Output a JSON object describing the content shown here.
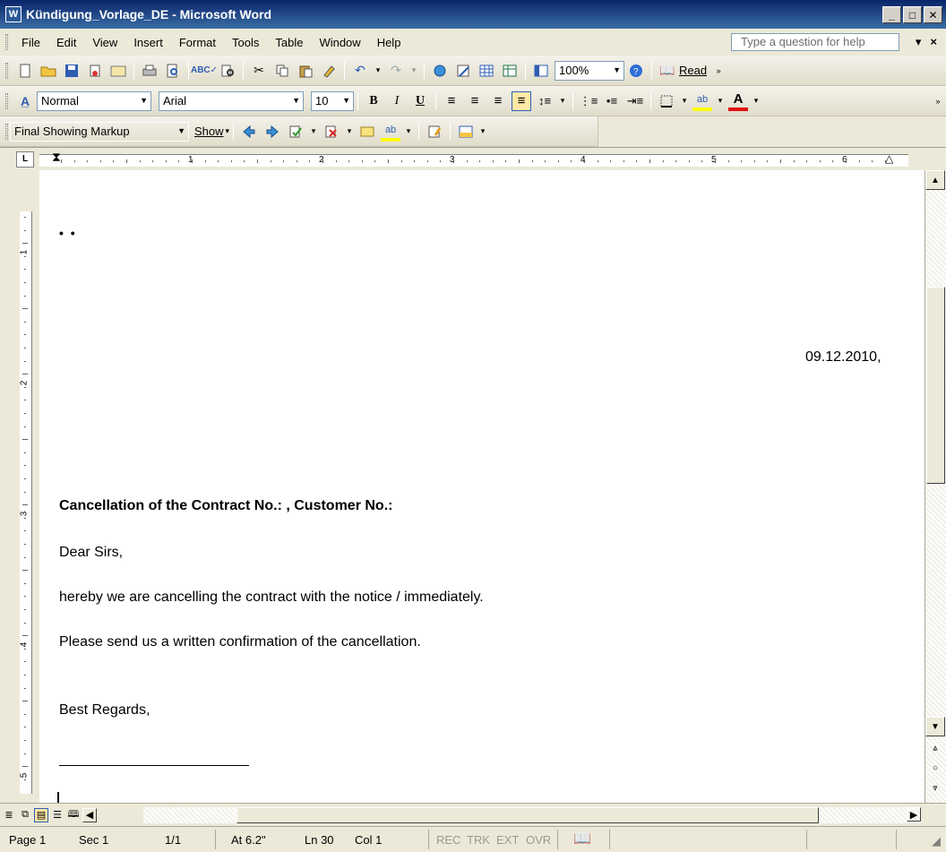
{
  "window": {
    "title": "Kündigung_Vorlage_DE - Microsoft Word",
    "app_icon_letter": "W"
  },
  "menubar": {
    "items": [
      "File",
      "Edit",
      "View",
      "Insert",
      "Format",
      "Tools",
      "Table",
      "Window",
      "Help"
    ],
    "help_placeholder": "Type a question for help",
    "close_glyph": "×"
  },
  "toolbar_standard": {
    "zoom": "100%",
    "read_label": "Read"
  },
  "toolbar_formatting": {
    "style": "Normal",
    "font": "Arial",
    "size": "10",
    "bold_label": "B",
    "italic_label": "I",
    "underline_label": "U",
    "font_color_label": "A"
  },
  "toolbar_reviewing": {
    "markup_mode": "Final Showing Markup",
    "show_label": "Show"
  },
  "ruler": {
    "numbers": [
      "1",
      "2",
      "3",
      "4",
      "5",
      "6"
    ],
    "vertical_numbers": [
      "1",
      "2",
      "3",
      "4",
      "5"
    ],
    "tab_selector": "L"
  },
  "document": {
    "mark": "• •",
    "date": "09.12.2010,",
    "subject": "Cancellation of the Contract No.: , Customer No.:",
    "salutation": "Dear Sirs,",
    "body1": "hereby we are cancelling the contract with the notice / immediately.",
    "body2": "Please send us a written confirmation of the cancellation.",
    "closing": "Best Regards,"
  },
  "statusbar": {
    "page": "Page 1",
    "sec": "Sec 1",
    "pages": "1/1",
    "at": "At 6.2\"",
    "ln": "Ln 30",
    "col": "Col 1",
    "rec": "REC",
    "trk": "TRK",
    "ext": "EXT",
    "ovr": "OVR"
  }
}
